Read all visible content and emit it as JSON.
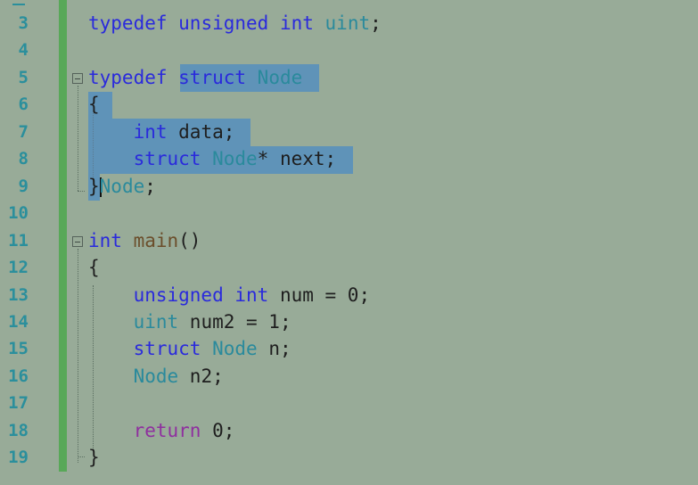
{
  "editor": {
    "lines": [
      {
        "num": "3",
        "segments": [
          [
            "kw",
            "typedef "
          ],
          [
            "kw",
            "unsigned "
          ],
          [
            "kw",
            "int "
          ],
          [
            "ty",
            "uint"
          ],
          [
            "",
            "; "
          ]
        ]
      },
      {
        "num": "4",
        "segments": []
      },
      {
        "num": "5",
        "segments": [
          [
            "kw",
            "typedef "
          ],
          [
            "kw",
            "struct "
          ],
          [
            "ty",
            "Node"
          ]
        ]
      },
      {
        "num": "6",
        "segments": [
          [
            "",
            "{"
          ]
        ]
      },
      {
        "num": "7",
        "segments": [
          [
            "",
            "    "
          ],
          [
            "kw",
            "int "
          ],
          [
            "",
            "data;"
          ]
        ]
      },
      {
        "num": "8",
        "segments": [
          [
            "",
            "    "
          ],
          [
            "kw",
            "struct "
          ],
          [
            "ty",
            "Node"
          ],
          [
            "",
            "* next;"
          ]
        ]
      },
      {
        "num": "9",
        "segments": [
          [
            "",
            "}"
          ],
          [
            "ty",
            "Node"
          ],
          [
            "",
            ";"
          ]
        ]
      },
      {
        "num": "10",
        "segments": []
      },
      {
        "num": "11",
        "segments": [
          [
            "kw",
            "int "
          ],
          [
            "fn",
            "main"
          ],
          [
            "",
            "()"
          ]
        ]
      },
      {
        "num": "12",
        "segments": [
          [
            "",
            "{"
          ]
        ]
      },
      {
        "num": "13",
        "segments": [
          [
            "",
            "    "
          ],
          [
            "kw",
            "unsigned "
          ],
          [
            "kw",
            "int "
          ],
          [
            "",
            "num = 0;"
          ]
        ]
      },
      {
        "num": "14",
        "segments": [
          [
            "",
            "    "
          ],
          [
            "ty",
            "uint "
          ],
          [
            "",
            "num2 = 1;"
          ]
        ]
      },
      {
        "num": "15",
        "segments": [
          [
            "",
            "    "
          ],
          [
            "kw",
            "struct "
          ],
          [
            "ty",
            "Node "
          ],
          [
            "",
            "n;"
          ]
        ]
      },
      {
        "num": "16",
        "segments": [
          [
            "",
            "    "
          ],
          [
            "ty",
            "Node "
          ],
          [
            "",
            "n2;"
          ]
        ]
      },
      {
        "num": "17",
        "segments": []
      },
      {
        "num": "18",
        "segments": [
          [
            "",
            "    "
          ],
          [
            "ret",
            "return "
          ],
          [
            "",
            "0;"
          ]
        ]
      },
      {
        "num": "19",
        "segments": [
          [
            "",
            "}"
          ]
        ]
      }
    ]
  }
}
